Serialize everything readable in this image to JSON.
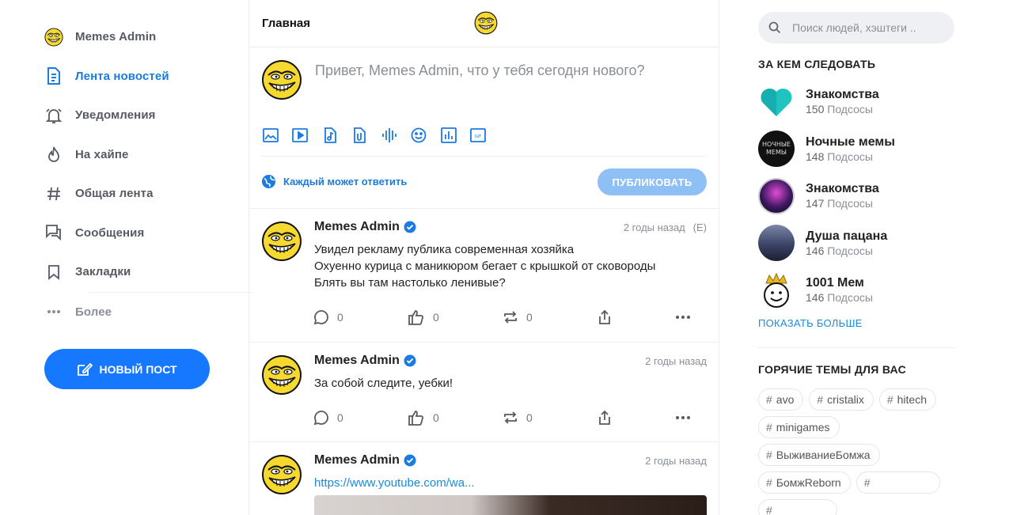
{
  "sidebar": {
    "items": [
      {
        "label": "Memes Admin",
        "icon": "profile-avatar-icon"
      },
      {
        "label": "Лента новостей",
        "icon": "news-feed-icon"
      },
      {
        "label": "Уведомления",
        "icon": "bell-icon"
      },
      {
        "label": "На хайпе",
        "icon": "flame-icon"
      },
      {
        "label": "Общая лента",
        "icon": "hashtag-icon"
      },
      {
        "label": "Сообщения",
        "icon": "messages-icon"
      },
      {
        "label": "Закладки",
        "icon": "bookmark-icon"
      },
      {
        "label": "Более",
        "icon": "more-dots-icon"
      }
    ],
    "active_index": 1,
    "new_post_label": "НОВЫЙ ПОСТ"
  },
  "header": {
    "title": "Главная"
  },
  "composer": {
    "prompt": "Привет, Memes Admin, что у тебя сегодня нового?",
    "tools": [
      "image-icon",
      "video-icon",
      "music-icon",
      "document-icon",
      "audio-wave-icon",
      "emoji-icon",
      "poll-icon",
      "gif-icon"
    ],
    "reply_setting": "Каждый может ответить",
    "publish_label": "ПУБЛИКОВАТЬ"
  },
  "posts": [
    {
      "author": "Memes Admin",
      "time": "2 годы назад",
      "edited": "(E)",
      "lines": [
        "Увидел рекламу публика современная хозяйка",
        "Охуенно курица с маникюром бегает с крышкой от сковороды",
        "Блять вы там настолько ленивые?"
      ],
      "comments": "0",
      "likes": "0",
      "reposts": "0"
    },
    {
      "author": "Memes Admin",
      "time": "2 годы назад",
      "lines": [
        "За собой следите, уебки!"
      ],
      "comments": "0",
      "likes": "0",
      "reposts": "0"
    },
    {
      "author": "Memes Admin",
      "time": "2 годы назад",
      "link": "https://www.youtube.com/wa..."
    }
  ],
  "right": {
    "search_placeholder": "Поиск людей, хэштеги ..",
    "follow_title": "ЗА КЕМ СЛЕДОВАТЬ",
    "follow": [
      {
        "name": "Знакомства",
        "count": "150",
        "suffix": "Подсосы",
        "avatar": "teal-heart-icon"
      },
      {
        "name": "Ночные мемы",
        "count": "148",
        "suffix": "Подсосы",
        "avatar": "night-memes-logo"
      },
      {
        "name": "Знакомства",
        "count": "147",
        "suffix": "Подсосы",
        "avatar": "neon-girl-avatar"
      },
      {
        "name": "Душа пацана",
        "count": "146",
        "suffix": "Подсосы",
        "avatar": "street-avatar"
      },
      {
        "name": "1001 Мем",
        "count": "146",
        "suffix": "Подсосы",
        "avatar": "crown-face-avatar"
      }
    ],
    "show_more": "ПОКАЗАТЬ БОЛЬШЕ",
    "topics_title": "ГОРЯЧИЕ ТЕМЫ ДЛЯ ВАС",
    "tags": [
      "avo",
      "cristalix",
      "hitech",
      "minigames",
      "ВыживаниеБомжа",
      "БомжReborn",
      "",
      ""
    ]
  },
  "colors": {
    "accent": "#1677ff",
    "link": "#1a8ae0",
    "publish_disabled": "#8ec0f5",
    "muted": "#8a8f97"
  }
}
